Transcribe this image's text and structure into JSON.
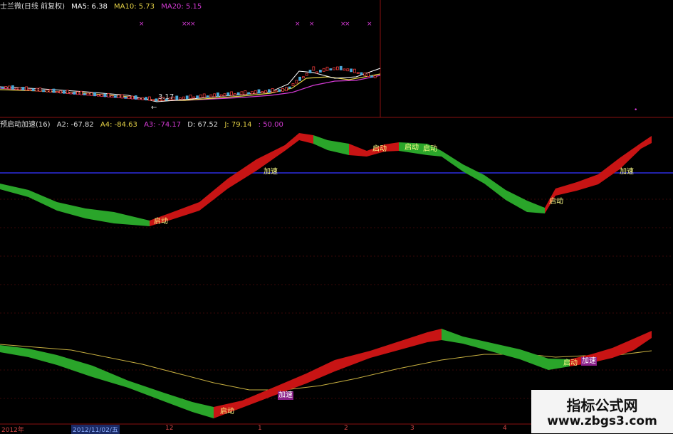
{
  "colors": {
    "up": "#c81414",
    "down": "#2aa52a",
    "ma5": "#ffffff",
    "ma10": "#e6d246",
    "ma20": "#d43ad4",
    "divider": "#8a1010",
    "midline": "#2222aa",
    "signal_start": "#ffff88",
    "signal_accel": "#ffffff",
    "signal_accel_bg": "#c030c0"
  },
  "price_panel": {
    "title": "士兰微(日线 前复权)",
    "ma5": "MA5: 6.38",
    "ma10": "MA10: 5.73",
    "ma20": "MA20: 5.15",
    "low_label": "3.17",
    "low_arrow": "←"
  },
  "indicator_panel": {
    "title": "预启动加速(16)",
    "a2": "A2: -67.82",
    "a4": "A4: -84.63",
    "a3": "A3: -74.17",
    "d": "D: 67.52",
    "j": "J: 79.14",
    "v": ": 50.00"
  },
  "signals": {
    "start": "启动",
    "accel": "加速"
  },
  "xaxis": {
    "left": "2012年",
    "date": "2012/11/02/五",
    "m12": "12",
    "m1": "1",
    "m2": "2",
    "m3": "3",
    "m4": "4"
  },
  "watermark": {
    "name": "指标公式网",
    "url": "www.zbgs3.com"
  }
}
